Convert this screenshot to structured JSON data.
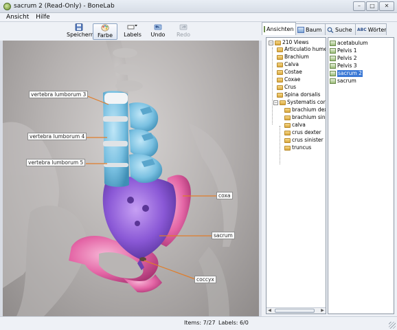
{
  "window": {
    "title": "sacrum 2 (Read-Only) - BoneLab"
  },
  "menu": [
    "Ansicht",
    "Hilfe"
  ],
  "toolbar": {
    "save": "Speichern",
    "color": "Farbe",
    "labels": "Labels",
    "undo": "Undo",
    "redo": "Redo"
  },
  "labels_3d": {
    "l3": "vertebra lumborum 3",
    "l4": "vertebra lumborum 4",
    "l5": "vertebra lumborum 5",
    "coxa": "coxa",
    "sacrum": "sacrum",
    "coccyx": "coccyx"
  },
  "tabs": [
    "Ansichten",
    "Baum",
    "Suche",
    "Wörter"
  ],
  "tree": {
    "root": "210 Views",
    "items": [
      "Articulatio humeri",
      "Brachium",
      "Calva",
      "Costae",
      "Coxae",
      "Crus",
      "Spina dorsalis"
    ],
    "group": "Systematis corporis",
    "subitems": [
      "brachium dextrum",
      "brachium sinistrum",
      "calva",
      "crus dexter",
      "crus sinister",
      "truncus"
    ]
  },
  "views": {
    "items": [
      "acetabulum",
      "Pelvis 1",
      "Pelvis 2",
      "Pelvis 3",
      "sacrum 2",
      "sacrum"
    ],
    "selected_index": 4
  },
  "status": {
    "items": "Items: 7/27",
    "labels": "Labels: 6/0"
  },
  "colors": {
    "vertebra": "#7ec3e3",
    "sacrum": "#8c5ad8",
    "coxa": "#e66aa8",
    "selection": "#3a78d5"
  }
}
